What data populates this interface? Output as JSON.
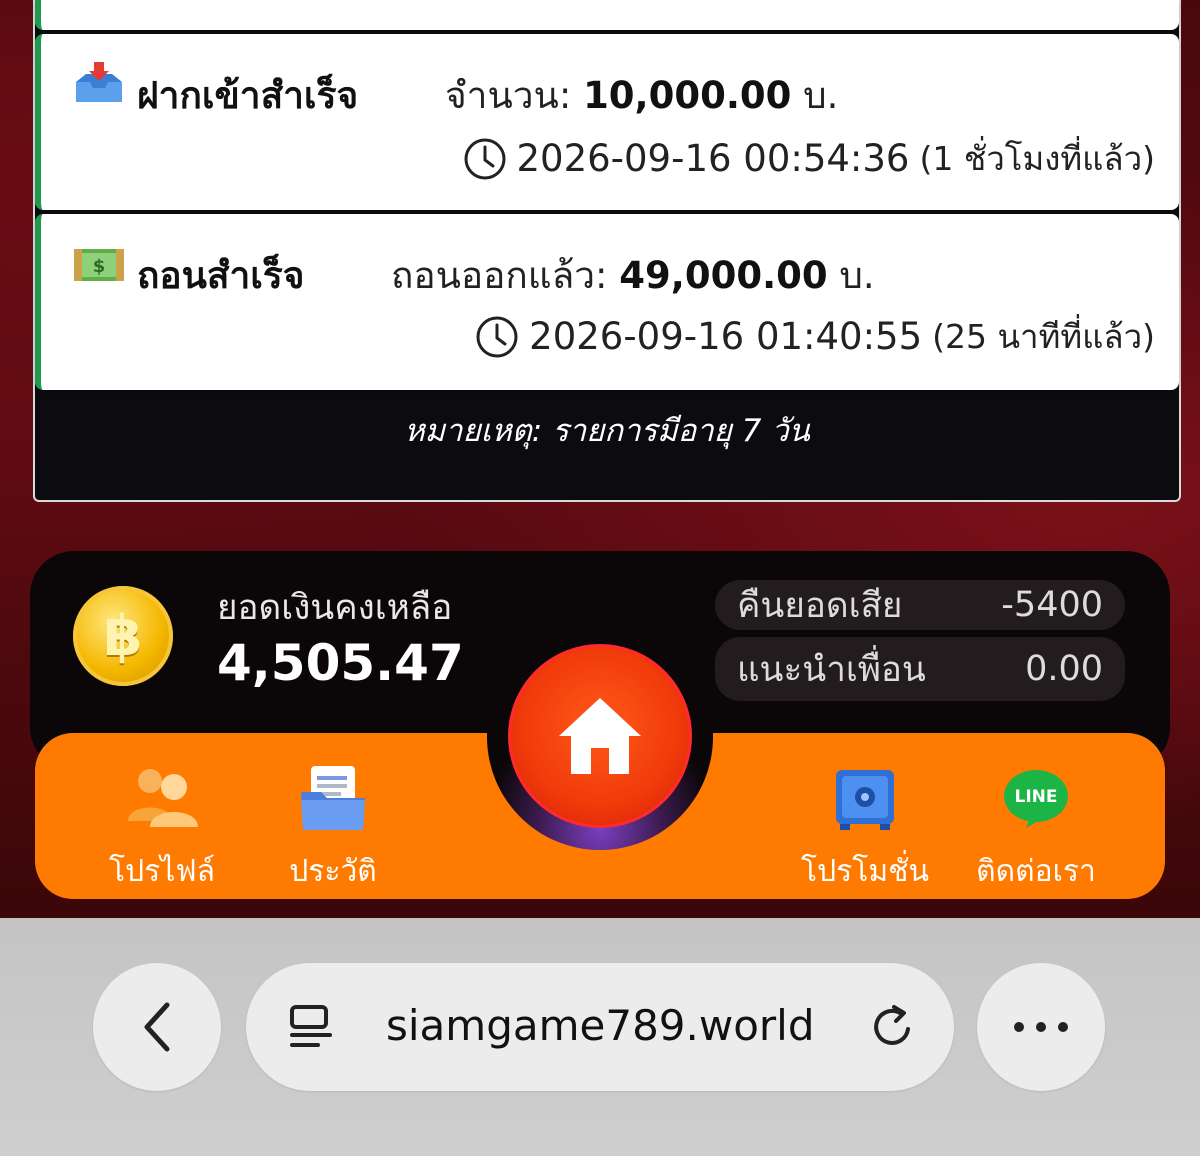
{
  "transactions": [
    {
      "title": "ฝากเข้าสำเร็จ",
      "amount_label": "จำนวน:",
      "amount": "10,000.00",
      "currency": "บ.",
      "datetime": "2026-09-16 00:54:36",
      "relative": "(1 ชั่วโมงที่แล้ว)",
      "icon": "inbox-tray-icon",
      "status_color": "#1f9a4f"
    },
    {
      "title": "ถอนสำเร็จ",
      "amount_label": "ถอนออกแล้ว:",
      "amount": "49,000.00",
      "currency": "บ.",
      "datetime": "2026-09-16 01:40:55",
      "relative": "(25 นาทีที่แล้ว)",
      "icon": "money-bill-icon",
      "status_color": "#1f9a4f"
    }
  ],
  "note": "หมายเหตุ: รายการมีอายุ 7 วัน",
  "balance": {
    "label": "ยอดเงินคงเหลือ",
    "value": "4,505.47",
    "coin_symbol": "฿"
  },
  "stats": [
    {
      "label": "คืนยอดเสีย",
      "value": "-5400"
    },
    {
      "label": "แนะนำเพื่อน",
      "value": "0.00"
    }
  ],
  "nav": {
    "profile": "โปรไฟล์",
    "history": "ประวัติ",
    "promotion": "โปรโมชั่น",
    "contact": "ติดต่อเรา",
    "line_badge": "LINE"
  },
  "browser": {
    "url": "siamgame789.world"
  },
  "colors": {
    "nav_orange": "#ff7a00",
    "home_red": "#f03a0a",
    "panel_dark": "#0c0c10"
  }
}
